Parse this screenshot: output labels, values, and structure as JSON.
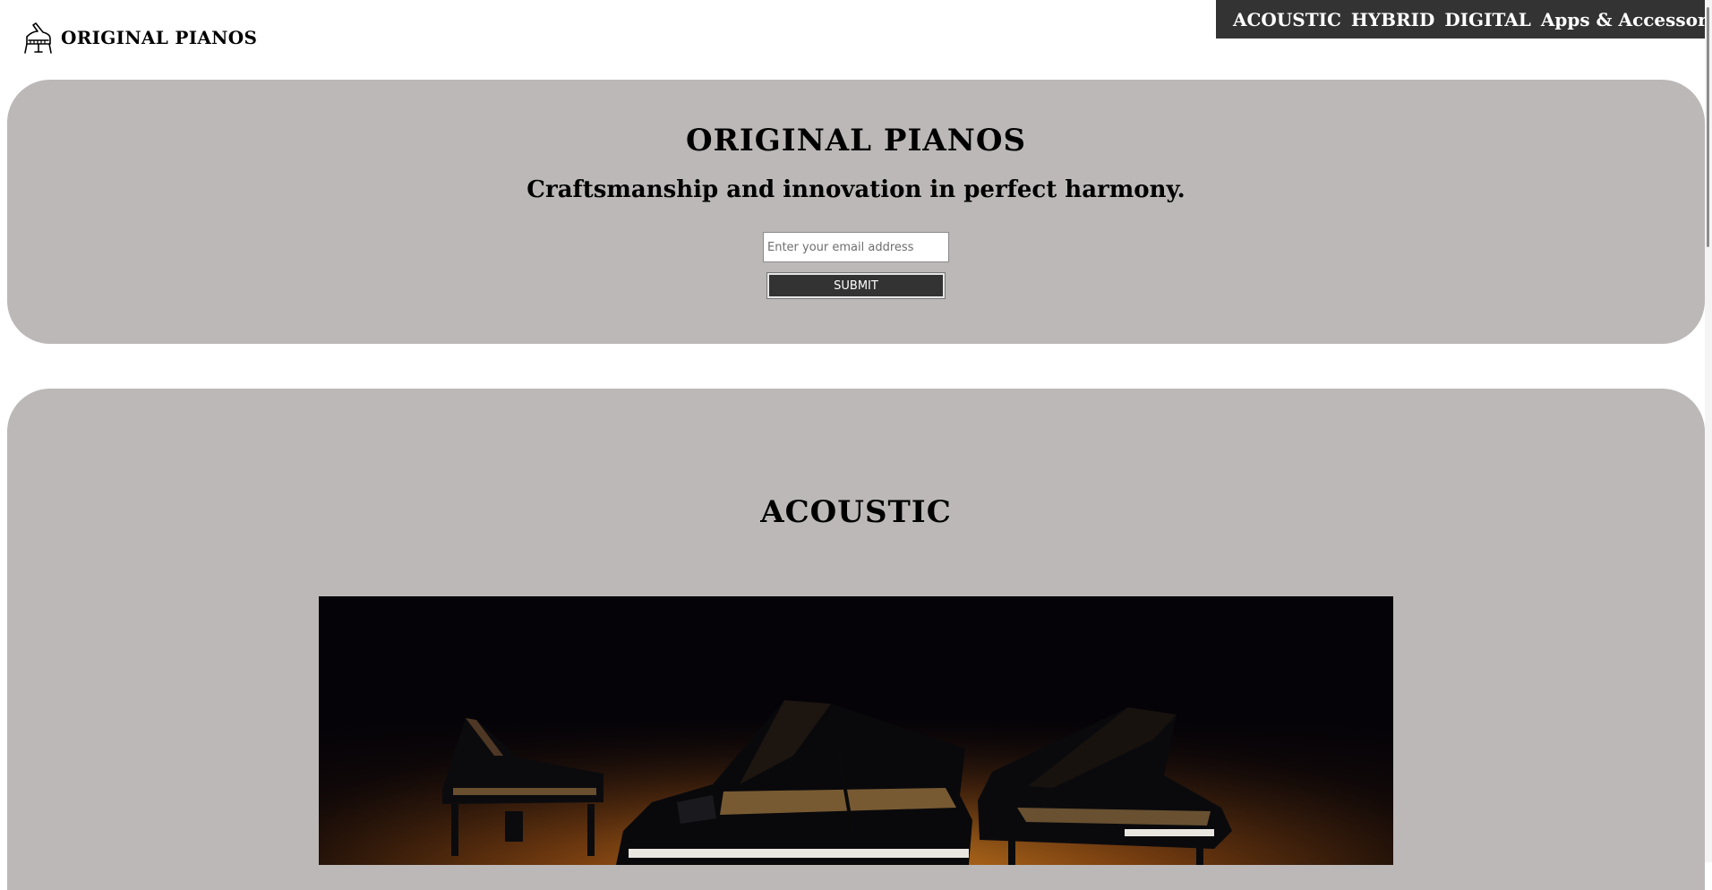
{
  "brand": {
    "name": "ORIGINAL PIANOS",
    "icon": "grand-piano-icon"
  },
  "nav": {
    "items": [
      {
        "label": "ACOUSTIC"
      },
      {
        "label": "HYBRID"
      },
      {
        "label": "DIGITAL"
      },
      {
        "label": "Apps & Accessories"
      }
    ]
  },
  "hero": {
    "title": "ORIGINAL PIANOS",
    "tagline": "Craftsmanship and innovation in perfect harmony.",
    "email_placeholder": "Enter your email address",
    "email_value": "",
    "submit_label": "SUBMIT"
  },
  "acoustic": {
    "title": "ACOUSTIC",
    "image": "three-grand-pianos-photo"
  },
  "colors": {
    "panel_bg": "#bcb8b8",
    "nav_bg": "#333333",
    "button_bg": "#333333",
    "text": "#000000"
  }
}
